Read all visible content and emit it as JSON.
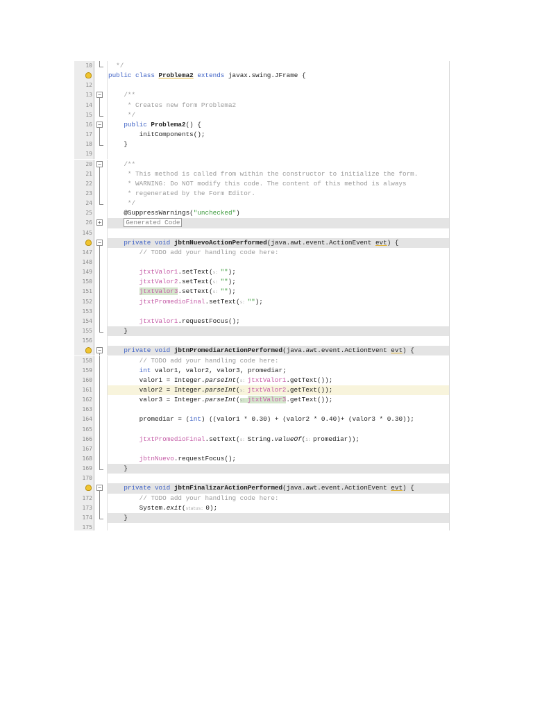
{
  "editor": {
    "lines": [
      {
        "n": "10",
        "fold": "close",
        "tk": [
          [
            "  */",
            "cm"
          ]
        ]
      },
      {
        "icon": "bulb",
        "tk": [
          [
            "public class ",
            "kw"
          ],
          [
            "Problema2",
            "b u"
          ],
          [
            " extends ",
            "kw"
          ],
          [
            "javax.swing.JFrame {",
            ""
          ]
        ]
      },
      {
        "n": "12",
        "tk": []
      },
      {
        "n": "13",
        "fold": "open",
        "tk": [
          [
            "    /**",
            "cm"
          ]
        ]
      },
      {
        "n": "14",
        "fold": "mid",
        "tk": [
          [
            "     * Creates new form Problema2",
            "cm"
          ]
        ]
      },
      {
        "n": "15",
        "fold": "close",
        "tk": [
          [
            "     */",
            "cm"
          ]
        ]
      },
      {
        "n": "16",
        "fold": "open",
        "tk": [
          [
            "    public ",
            "kw"
          ],
          [
            "Problema2",
            "b"
          ],
          [
            "() {",
            ""
          ]
        ]
      },
      {
        "n": "17",
        "fold": "mid",
        "tk": [
          [
            "        initComponents();",
            ""
          ]
        ]
      },
      {
        "n": "18",
        "fold": "close",
        "tk": [
          [
            "    }",
            ""
          ]
        ]
      },
      {
        "n": "19",
        "tk": []
      },
      {
        "n": "20",
        "fold": "open",
        "tk": [
          [
            "    /**",
            "cm"
          ]
        ]
      },
      {
        "n": "21",
        "fold": "mid",
        "tk": [
          [
            "     * This method is called from within the constructor to initialize the form.",
            "cm"
          ]
        ]
      },
      {
        "n": "22",
        "fold": "mid",
        "tk": [
          [
            "     * WARNING: Do NOT modify this code. The content of this method is always",
            "cm"
          ]
        ]
      },
      {
        "n": "23",
        "fold": "mid",
        "tk": [
          [
            "     * regenerated by the Form Editor.",
            "cm"
          ]
        ]
      },
      {
        "n": "24",
        "fold": "close",
        "tk": [
          [
            "     */",
            "cm"
          ]
        ]
      },
      {
        "n": "25",
        "tk": [
          [
            "    @SuppressWarnings(",
            ""
          ],
          [
            "\"unchecked\"",
            "str"
          ],
          [
            ")",
            ""
          ]
        ]
      },
      {
        "n": "26",
        "fold": "plus",
        "hl": "gray",
        "tk": [
          [
            "    ",
            ""
          ],
          [
            "Generated Code",
            "gen"
          ]
        ]
      },
      {
        "n": "145",
        "tk": []
      },
      {
        "icon": "bulb",
        "fold": "open",
        "hl": "gray",
        "tk": [
          [
            "    private void ",
            "kw"
          ],
          [
            "jbtnNuevoActionPerformed",
            "b"
          ],
          [
            "(java.awt.event.ActionEvent ",
            ""
          ],
          [
            "evt",
            "u"
          ],
          [
            ") {",
            ""
          ]
        ]
      },
      {
        "n": "147",
        "fold": "mid",
        "tk": [
          [
            "        // TODO add your handling code here:",
            "cm"
          ]
        ]
      },
      {
        "n": "148",
        "fold": "mid",
        "tk": []
      },
      {
        "n": "149",
        "fold": "mid",
        "tk": [
          [
            "        ",
            ""
          ],
          [
            "jtxtValor1",
            "fld"
          ],
          [
            ".setText(",
            ""
          ],
          [
            "s: ",
            "hint"
          ],
          [
            "\"\"",
            "str"
          ],
          [
            ");",
            ""
          ]
        ]
      },
      {
        "n": "150",
        "fold": "mid",
        "tk": [
          [
            "        ",
            ""
          ],
          [
            "jtxtValor2",
            "fld"
          ],
          [
            ".setText(",
            ""
          ],
          [
            "s: ",
            "hint"
          ],
          [
            "\"\"",
            "str"
          ],
          [
            ");",
            ""
          ]
        ]
      },
      {
        "n": "151",
        "fold": "mid",
        "tk": [
          [
            "        ",
            ""
          ],
          [
            "jtxtValor3",
            "fld g"
          ],
          [
            ".setText(",
            ""
          ],
          [
            "s: ",
            "hint"
          ],
          [
            "\"\"",
            "str"
          ],
          [
            ");",
            ""
          ]
        ]
      },
      {
        "n": "152",
        "fold": "mid",
        "tk": [
          [
            "        ",
            ""
          ],
          [
            "jtxtPromedioFinal",
            "fld"
          ],
          [
            ".setText(",
            ""
          ],
          [
            "s: ",
            "hint"
          ],
          [
            "\"\"",
            "str"
          ],
          [
            ");",
            ""
          ]
        ]
      },
      {
        "n": "153",
        "fold": "mid",
        "tk": []
      },
      {
        "n": "154",
        "fold": "mid",
        "tk": [
          [
            "        ",
            ""
          ],
          [
            "jtxtValor1",
            "fld"
          ],
          [
            ".requestFocus();",
            ""
          ]
        ]
      },
      {
        "n": "155",
        "fold": "close",
        "hl": "gray",
        "tk": [
          [
            "    }",
            ""
          ]
        ]
      },
      {
        "n": "156",
        "tk": []
      },
      {
        "icon": "bulb",
        "fold": "open",
        "hl": "gray",
        "tk": [
          [
            "    private void ",
            "kw"
          ],
          [
            "jbtnPromediarActionPerformed",
            "b"
          ],
          [
            "(java.awt.event.ActionEvent ",
            ""
          ],
          [
            "evt",
            "u"
          ],
          [
            ") {",
            ""
          ]
        ]
      },
      {
        "n": "158",
        "fold": "mid",
        "tk": [
          [
            "        // TODO add your handling code here:",
            "cm"
          ]
        ]
      },
      {
        "n": "159",
        "fold": "mid",
        "tk": [
          [
            "        ",
            ""
          ],
          [
            "int ",
            "kw"
          ],
          [
            "valor1, valor2, valor3, promediar;",
            ""
          ]
        ]
      },
      {
        "n": "160",
        "fold": "mid",
        "tk": [
          [
            "        valor1 = Integer.",
            ""
          ],
          [
            "parseInt",
            "it"
          ],
          [
            "(",
            ""
          ],
          [
            "s: ",
            "hint"
          ],
          [
            "jtxtValor1",
            "fld"
          ],
          [
            ".getText());",
            ""
          ]
        ]
      },
      {
        "n": "161",
        "fold": "mid",
        "hl": "yellow",
        "tk": [
          [
            "        valor2 = Integer.",
            ""
          ],
          [
            "parseInt",
            "it"
          ],
          [
            "(",
            ""
          ],
          [
            "s: ",
            "hint"
          ],
          [
            "jtxtValor2",
            "fld"
          ],
          [
            ".getText());",
            ""
          ]
        ]
      },
      {
        "n": "162",
        "fold": "mid",
        "tk": [
          [
            "        valor3 = Integer.",
            ""
          ],
          [
            "parseInt",
            "it"
          ],
          [
            "(",
            ""
          ],
          [
            "s: ",
            "hint g"
          ],
          [
            "jtxtValor3",
            "fld g"
          ],
          [
            ".getText());",
            ""
          ]
        ]
      },
      {
        "n": "163",
        "fold": "mid",
        "tk": []
      },
      {
        "n": "164",
        "fold": "mid",
        "tk": [
          [
            "        promediar = (",
            ""
          ],
          [
            "int",
            "kw"
          ],
          [
            ") ((valor1 * 0.30) + (valor2 * 0.40)+ (valor3 * 0.30));",
            ""
          ]
        ]
      },
      {
        "n": "165",
        "fold": "mid",
        "tk": []
      },
      {
        "n": "166",
        "fold": "mid",
        "tk": [
          [
            "        ",
            ""
          ],
          [
            "jtxtPromedioFinal",
            "fld"
          ],
          [
            ".setText(",
            ""
          ],
          [
            "s: ",
            "hint"
          ],
          [
            "String.",
            ""
          ],
          [
            "valueOf",
            "it"
          ],
          [
            "(",
            ""
          ],
          [
            "i: ",
            "hint"
          ],
          [
            "promediar));",
            ""
          ]
        ]
      },
      {
        "n": "167",
        "fold": "mid",
        "tk": []
      },
      {
        "n": "168",
        "fold": "mid",
        "tk": [
          [
            "        ",
            ""
          ],
          [
            "jbtnNuevo",
            "fld"
          ],
          [
            ".requestFocus();",
            ""
          ]
        ]
      },
      {
        "n": "169",
        "fold": "close",
        "hl": "gray",
        "tk": [
          [
            "    }",
            ""
          ]
        ]
      },
      {
        "n": "170",
        "tk": []
      },
      {
        "icon": "bulb",
        "fold": "open",
        "hl": "gray",
        "tk": [
          [
            "    private void ",
            "kw"
          ],
          [
            "jbtnFinalizarActionPerformed",
            "b"
          ],
          [
            "(java.awt.event.ActionEvent ",
            ""
          ],
          [
            "evt",
            "u"
          ],
          [
            ") {",
            ""
          ]
        ]
      },
      {
        "n": "172",
        "fold": "mid",
        "tk": [
          [
            "        // TODO add your handling code here:",
            "cm"
          ]
        ]
      },
      {
        "n": "173",
        "fold": "mid",
        "tk": [
          [
            "        System.",
            ""
          ],
          [
            "exit",
            "it"
          ],
          [
            "(",
            ""
          ],
          [
            "status: ",
            "hint"
          ],
          [
            "0);",
            ""
          ]
        ]
      },
      {
        "n": "174",
        "fold": "close",
        "hl": "gray",
        "tk": [
          [
            "    }",
            ""
          ]
        ]
      },
      {
        "n": "175",
        "tk": []
      }
    ]
  }
}
